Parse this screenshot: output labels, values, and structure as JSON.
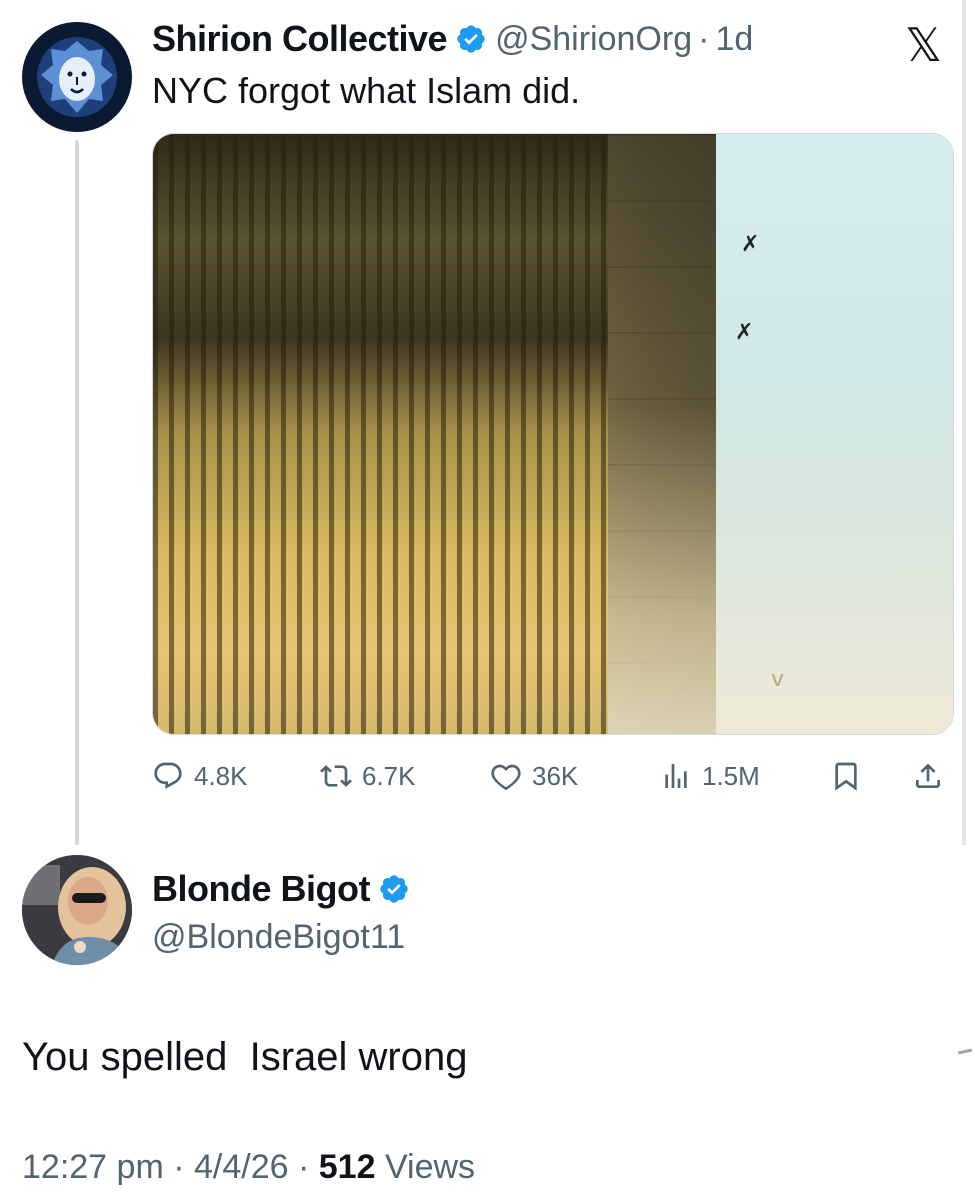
{
  "original_post": {
    "author_name": "Shirion Collective",
    "handle": "@ShirionOrg",
    "separator": "·",
    "time_ago": "1d",
    "text": "NYC forgot what Islam did.",
    "platform_logo": "𝕏",
    "metrics": {
      "replies": "4.8K",
      "reposts": "6.7K",
      "likes": "36K",
      "views": "1.5M"
    }
  },
  "reply": {
    "author_name": "Blonde Bigot",
    "handle": "@BlondeBigot11",
    "text": "You spelled  Israel wrong",
    "timestamp": "12:27 pm",
    "date": "4/4/26",
    "views_count": "512",
    "views_label": "Views",
    "separator": "·"
  },
  "colors": {
    "verified_blue": "#1d9bf0",
    "secondary_text": "#536471",
    "primary_text": "#0f1419"
  },
  "icons": [
    "lion-avatar-icon",
    "verified-badge-icon",
    "x-logo-icon",
    "reply-icon",
    "repost-icon",
    "like-icon",
    "views-icon",
    "bookmark-icon",
    "share-icon"
  ]
}
